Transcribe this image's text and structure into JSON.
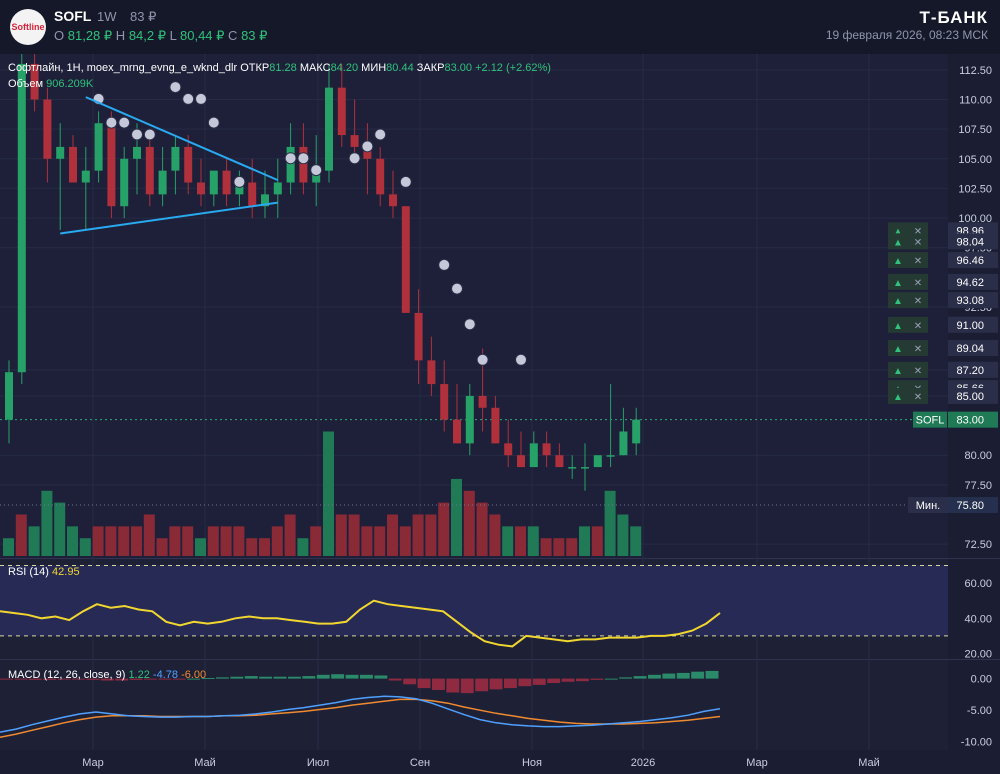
{
  "header": {
    "logo_text": "Softline",
    "ticker": "SOFL",
    "timeframe": "1W",
    "last_price": "83 ₽",
    "open_label": "O",
    "open_value": "81,28 ₽",
    "high_label": "H",
    "high_value": "84,2 ₽",
    "low_label": "L",
    "low_value": "80,44 ₽",
    "close_label": "C",
    "close_value": "83 ₽",
    "brand": "Т‑БАНК",
    "datetime": "19 февраля 2026, 08:23 МСК"
  },
  "legend": {
    "symbol_line": "Софтлайн, 1H, moex_mrng_evng_e_wknd_dlr",
    "open_label": "ОТКР",
    "open_value": "81.28",
    "high_label": "МАКС",
    "high_value": "84.20",
    "low_label": "МИН",
    "low_value": "80.44",
    "close_label": "ЗАКР",
    "close_value": "83.00",
    "change": "+2.12 (+2.62%)",
    "volume_label": "Объем",
    "volume_value": "906.209K"
  },
  "rsi_legend": {
    "label": "RSI (14)",
    "value": "42.95"
  },
  "macd_legend": {
    "label": "MACD (12, 26, close, 9)",
    "hist": "1.22",
    "macd": "-4.78",
    "signal": "-6.00"
  },
  "price_tag": {
    "label": "SOFL",
    "value": "83.00"
  },
  "min_tag": {
    "label": "Мин.",
    "value": "75.80"
  },
  "colors": {
    "up": "#26a269",
    "down": "#b0303c",
    "rsi": "#f2d630",
    "macd": "#4fa0ff",
    "signal": "#f08a30",
    "trend": "#29a9f0",
    "bg": "#1d2038"
  },
  "chart_data": [
    {
      "type": "candlestick",
      "ylim": [
        71.5,
        113.5
      ],
      "y_ticks": [
        "112.50",
        "110.00",
        "107.50",
        "105.00",
        "102.50",
        "100.00",
        "97.50",
        "92.50",
        "87.20",
        "85.00",
        "80.00",
        "77.50",
        "72.50"
      ],
      "x_ticks": [
        "Мар",
        "Май",
        "Июл",
        "Сен",
        "Ноя",
        "2026",
        "Мар",
        "Май"
      ],
      "alert_levels": [
        "98.96",
        "98.04",
        "96.46",
        "94.62",
        "93.08",
        "91.00",
        "89.04",
        "87.20",
        "85.66",
        "85.00"
      ],
      "candles": [
        [
          83,
          88,
          81,
          87
        ],
        [
          87,
          115,
          86,
          113
        ],
        [
          113,
          114,
          109,
          110
        ],
        [
          110,
          111,
          103,
          105
        ],
        [
          105,
          108,
          99,
          106
        ],
        [
          106,
          107,
          103,
          103
        ],
        [
          103,
          106,
          99,
          104
        ],
        [
          104,
          109,
          103,
          108
        ],
        [
          108,
          109,
          100,
          101
        ],
        [
          101,
          106,
          100,
          105
        ],
        [
          105,
          108,
          102,
          106
        ],
        [
          106,
          107,
          101,
          102
        ],
        [
          102,
          106,
          101,
          104
        ],
        [
          104,
          107,
          102,
          106
        ],
        [
          106,
          107,
          102,
          103
        ],
        [
          103,
          105,
          101,
          102
        ],
        [
          102,
          104,
          101,
          104
        ],
        [
          104,
          105,
          101,
          102
        ],
        [
          102,
          104,
          101,
          103
        ],
        [
          103,
          105,
          100,
          101
        ],
        [
          101,
          104,
          100,
          102
        ],
        [
          102,
          105,
          100,
          103
        ],
        [
          103,
          108,
          102,
          106
        ],
        [
          106,
          108,
          102,
          103
        ],
        [
          103,
          107,
          101,
          104
        ],
        [
          104,
          113,
          103,
          111
        ],
        [
          111,
          113,
          106,
          107
        ],
        [
          107,
          110,
          105,
          106
        ],
        [
          106,
          108,
          102,
          105
        ],
        [
          105,
          106,
          101,
          102
        ],
        [
          102,
          104,
          100,
          101
        ],
        [
          101,
          101,
          94,
          92
        ],
        [
          92,
          94,
          86,
          88
        ],
        [
          88,
          90,
          85,
          86
        ],
        [
          86,
          88,
          82,
          83
        ],
        [
          83,
          86,
          81,
          81
        ],
        [
          81,
          86,
          80,
          85
        ],
        [
          85,
          89,
          82,
          84
        ],
        [
          84,
          85,
          81,
          81
        ],
        [
          81,
          83,
          79,
          80
        ],
        [
          80,
          82,
          79,
          79
        ],
        [
          79,
          82,
          79,
          81
        ],
        [
          81,
          82,
          79,
          80
        ],
        [
          80,
          81,
          79,
          79
        ],
        [
          79,
          80,
          78,
          79
        ],
        [
          79,
          81,
          77,
          79
        ],
        [
          79,
          80,
          79,
          80
        ],
        [
          80,
          86,
          79,
          80
        ],
        [
          80,
          84,
          80,
          82
        ],
        [
          81,
          84,
          80,
          83
        ]
      ],
      "volume": [
        [
          73,
          "up"
        ],
        [
          75,
          "down"
        ],
        [
          74,
          "up"
        ],
        [
          77,
          "up"
        ],
        [
          76,
          "up"
        ],
        [
          74,
          "up"
        ],
        [
          73,
          "up"
        ],
        [
          74,
          "down"
        ],
        [
          74,
          "down"
        ],
        [
          74,
          "down"
        ],
        [
          74,
          "down"
        ],
        [
          75,
          "down"
        ],
        [
          73,
          "down"
        ],
        [
          74,
          "down"
        ],
        [
          74,
          "down"
        ],
        [
          73,
          "up"
        ],
        [
          74,
          "down"
        ],
        [
          74,
          "down"
        ],
        [
          74,
          "down"
        ],
        [
          73,
          "down"
        ],
        [
          73,
          "down"
        ],
        [
          74,
          "down"
        ],
        [
          75,
          "down"
        ],
        [
          73,
          "up"
        ],
        [
          74,
          "down"
        ],
        [
          82,
          "up"
        ],
        [
          75,
          "down"
        ],
        [
          75,
          "down"
        ],
        [
          74,
          "down"
        ],
        [
          74,
          "down"
        ],
        [
          75,
          "down"
        ],
        [
          74,
          "down"
        ],
        [
          75,
          "down"
        ],
        [
          75,
          "down"
        ],
        [
          76,
          "down"
        ],
        [
          78,
          "up"
        ],
        [
          77,
          "down"
        ],
        [
          76,
          "down"
        ],
        [
          75,
          "down"
        ],
        [
          74,
          "up"
        ],
        [
          74,
          "down"
        ],
        [
          74,
          "up"
        ],
        [
          73,
          "down"
        ],
        [
          73,
          "down"
        ],
        [
          73,
          "down"
        ],
        [
          74,
          "up"
        ],
        [
          74,
          "down"
        ],
        [
          77,
          "up"
        ],
        [
          75,
          "up"
        ],
        [
          74,
          "up"
        ]
      ],
      "trendlines": [
        {
          "from": [
            6,
            110.2
          ],
          "to": [
            21,
            103.2
          ]
        },
        {
          "from": [
            4,
            98.7
          ],
          "to": [
            21,
            101.3
          ]
        }
      ]
    },
    {
      "type": "line",
      "title": "RSI (14)",
      "ylim": [
        18,
        72
      ],
      "y_ticks": [
        "60.00",
        "40.00",
        "20.00"
      ],
      "levels": [
        70,
        30
      ],
      "values": [
        44,
        43,
        42,
        40,
        41,
        39,
        44,
        48,
        46,
        47,
        45,
        44,
        38,
        36,
        38,
        37,
        38,
        40,
        41,
        40,
        40,
        39,
        38,
        37,
        37,
        38,
        45,
        50,
        48,
        47,
        46,
        45,
        44,
        38,
        32,
        27,
        25,
        24,
        30,
        29,
        28,
        27,
        28,
        28,
        29,
        29,
        29,
        30,
        30,
        31,
        33,
        37,
        43
      ]
    },
    {
      "type": "bar_line",
      "title": "MACD (12, 26, close, 9)",
      "ylim": [
        -11,
        2
      ],
      "y_ticks": [
        "0.00",
        "-5.00",
        "-10.00"
      ],
      "histogram": [
        -0.1,
        -0.1,
        -0.2,
        -0.2,
        -0.1,
        -0.1,
        -0.2,
        -0.3,
        -0.3,
        -0.2,
        -0.1,
        -0.1,
        -0.1,
        0,
        0.1,
        0.2,
        0.3,
        0.4,
        0.3,
        0.3,
        0.3,
        0.4,
        0.6,
        0.7,
        0.6,
        0.6,
        0.5,
        -0.3,
        -0.9,
        -1.5,
        -1.8,
        -2.2,
        -2.3,
        -2.0,
        -1.7,
        -1.5,
        -1.2,
        -1.0,
        -0.7,
        -0.5,
        -0.4,
        -0.2,
        0,
        0.2,
        0.4,
        0.6,
        0.8,
        0.9,
        1.1,
        1.22
      ],
      "macd": [
        -8.5,
        -8.0,
        -7.3,
        -6.7,
        -6.1,
        -5.6,
        -5.3,
        -5.6,
        -5.9,
        -6.0,
        -6.1,
        -6.1,
        -6.0,
        -6.0,
        -5.9,
        -5.8,
        -5.6,
        -5.3,
        -4.9,
        -4.6,
        -4.2,
        -3.8,
        -3.3,
        -3.0,
        -2.8,
        -2.9,
        -3.2,
        -3.9,
        -4.8,
        -5.7,
        -6.5,
        -7.0,
        -7.3,
        -7.5,
        -7.6,
        -7.6,
        -7.5,
        -7.4,
        -7.2,
        -7.0,
        -6.8,
        -6.5,
        -6.2,
        -5.8,
        -5.2,
        -4.78
      ],
      "signal": [
        -9.3,
        -8.8,
        -8.2,
        -7.6,
        -7.0,
        -6.5,
        -6.1,
        -5.9,
        -5.9,
        -5.9,
        -6.0,
        -6.0,
        -6.0,
        -6.0,
        -5.9,
        -5.9,
        -5.8,
        -5.6,
        -5.4,
        -5.2,
        -4.9,
        -4.6,
        -4.2,
        -3.9,
        -3.6,
        -3.3,
        -3.3,
        -3.5,
        -3.9,
        -4.5,
        -5.0,
        -5.5,
        -5.9,
        -6.3,
        -6.6,
        -6.9,
        -7.1,
        -7.2,
        -7.2,
        -7.2,
        -7.1,
        -7.0,
        -6.8,
        -6.6,
        -6.3,
        -6.0
      ]
    }
  ]
}
